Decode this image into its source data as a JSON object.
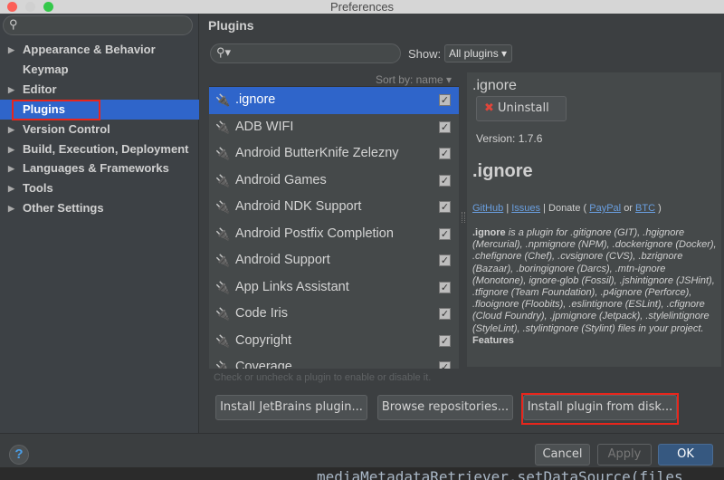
{
  "window": {
    "title": "Preferences"
  },
  "sidebar": {
    "items": [
      {
        "label": "Appearance & Behavior",
        "arrow": true
      },
      {
        "label": "Keymap",
        "arrow": false
      },
      {
        "label": "Editor",
        "arrow": true
      },
      {
        "label": "Plugins",
        "arrow": false,
        "selected": true
      },
      {
        "label": "Version Control",
        "arrow": true
      },
      {
        "label": "Build, Execution, Deployment",
        "arrow": true
      },
      {
        "label": "Languages & Frameworks",
        "arrow": true
      },
      {
        "label": "Tools",
        "arrow": true
      },
      {
        "label": "Other Settings",
        "arrow": true
      }
    ]
  },
  "main": {
    "title": "Plugins",
    "show_label": "Show:",
    "show_value": "All plugins",
    "sort_label": "Sort by: name",
    "plugins": [
      ".ignore",
      "ADB WIFI",
      "Android ButterKnife Zelezny",
      "Android Games",
      "Android NDK Support",
      "Android Postfix Completion",
      "Android Support",
      "App Links Assistant",
      "Code Iris",
      "Copyright",
      "Coverage"
    ],
    "hint": "Check or uncheck a plugin to enable or disable it.",
    "buttons": {
      "jetbrains": "Install JetBrains plugin...",
      "browse": "Browse repositories...",
      "disk": "Install plugin from disk..."
    }
  },
  "detail": {
    "name": ".ignore",
    "uninstall": "Uninstall",
    "version": "Version: 1.7.6",
    "heading": ".ignore",
    "links": {
      "github": "GitHub",
      "sep1": "|",
      "issues": "Issues",
      "donate": "| Donate (",
      "paypal": "PayPal",
      "or": "or",
      "btc": "BTC",
      "close": ")"
    },
    "desc_bold": ".ignore",
    "desc": " is a plugin for .gitignore (GIT), .hgignore (Mercurial), .npmignore (NPM), .dockerignore (Docker), .chefignore (Chef), .cvsignore (CVS), .bzrignore (Bazaar), .boringignore (Darcs), .mtn-ignore (Monotone), ignore-glob (Fossil), .jshintignore (JSHint), .tfignore (Team Foundation), .p4ignore (Perforce), .flooignore (Floobits), .eslintignore (ESLint), .cfignore (Cloud Foundry), .jpmignore (Jetpack), .stylelintignore (StyleLint), .stylintignore (Stylint) files in your project.",
    "features": "Features"
  },
  "footer": {
    "help": "?",
    "cancel": "Cancel",
    "apply": "Apply",
    "ok": "OK"
  },
  "background_code": "mediaMetadataRetriever.setDataSource(files"
}
